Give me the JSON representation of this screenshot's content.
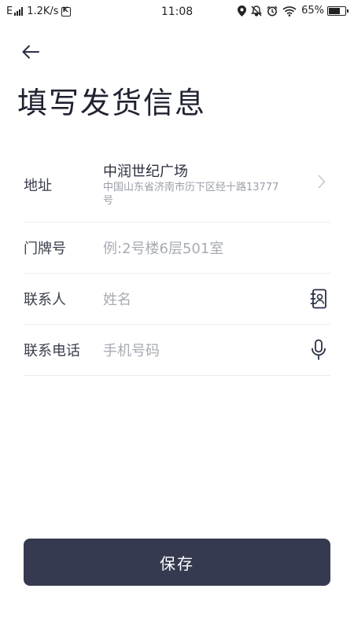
{
  "status_bar": {
    "network": "E",
    "speed": "1.2K/s",
    "time": "11:08",
    "battery": "65%",
    "battery_level": 0.65
  },
  "header": {
    "back_icon": "arrow-left-icon",
    "title": "填写发货信息"
  },
  "form": {
    "address": {
      "label": "地址",
      "name": "中润世纪广场",
      "detail": "中国山东省济南市历下区经十路13777号"
    },
    "door_number": {
      "label": "门牌号",
      "placeholder": "例:2号楼6层501室"
    },
    "contact": {
      "label": "联系人",
      "placeholder": "姓名",
      "icon": "contacts-book-icon"
    },
    "phone": {
      "label": "联系电话",
      "placeholder": "手机号码",
      "icon": "microphone-icon"
    }
  },
  "save_button": {
    "label": "保存"
  },
  "colors": {
    "primary": "#363a50",
    "placeholder": "#a7abb3",
    "divider": "#ececef"
  }
}
